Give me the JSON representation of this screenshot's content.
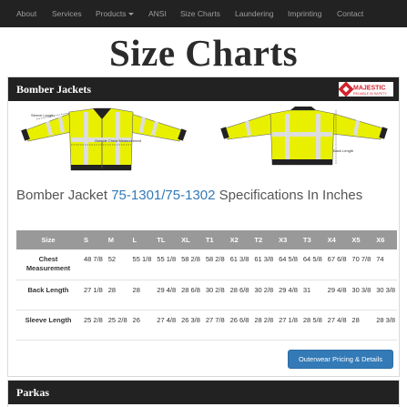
{
  "nav": {
    "items": [
      "About",
      "Services",
      "Products",
      "ANSI",
      "Size Charts",
      "Laundering",
      "Imprinting",
      "Contact"
    ]
  },
  "page_title": "Size Charts",
  "logo": {
    "brand": "MAJESTIC",
    "tagline": "RELIABLE IN SAFETY"
  },
  "colors": {
    "navbar": "#222222",
    "link": "#337ab7",
    "table_header": "#999999",
    "jacket": "#e8f000"
  },
  "bomber_jackets": {
    "heading": "Bomber Jackets",
    "diagram_labels": {
      "sleeve": "Sleeve Length",
      "chest": "Outside Chest Measurement",
      "back": "Back Length"
    },
    "spec_prefix": "Bomber Jacket ",
    "spec_link": "75-1301/75-1302",
    "spec_suffix": " Specifications In Inches",
    "table": {
      "headers": [
        "Size",
        "S",
        "M",
        "L",
        "TL",
        "XL",
        "T1",
        "X2",
        "T2",
        "X3",
        "T3",
        "X4",
        "X5",
        "X6"
      ],
      "rows": [
        {
          "label": "Chest Measurement",
          "cells": [
            "48 7/8",
            "52",
            "55 1/8",
            "55 1/8",
            "58 2/8",
            "58 2/8",
            "61 3/8",
            "61 3/8",
            "64 5/8",
            "64 5/8",
            "67 6/8",
            "70 7/8",
            "74"
          ]
        },
        {
          "label": "Back Length",
          "cells": [
            "27 1/8",
            "28",
            "28",
            "29 4/8",
            "28 6/8",
            "30 2/8",
            "28 6/8",
            "30 2/8",
            "29 4/8",
            "31",
            "29 4/8",
            "30 3/8",
            "30 3/8"
          ]
        },
        {
          "label": "Sleeve Length",
          "cells": [
            "25 2/8",
            "25 2/8",
            "26",
            "27 4/8",
            "26 3/8",
            "27 7/8",
            "26 6/8",
            "28 2/8",
            "27 1/8",
            "28 5/8",
            "27 4/8",
            "28",
            "28 3/8"
          ]
        }
      ]
    },
    "button": "Outerwear Pricing & Details"
  },
  "parkas": {
    "heading": "Parkas"
  }
}
